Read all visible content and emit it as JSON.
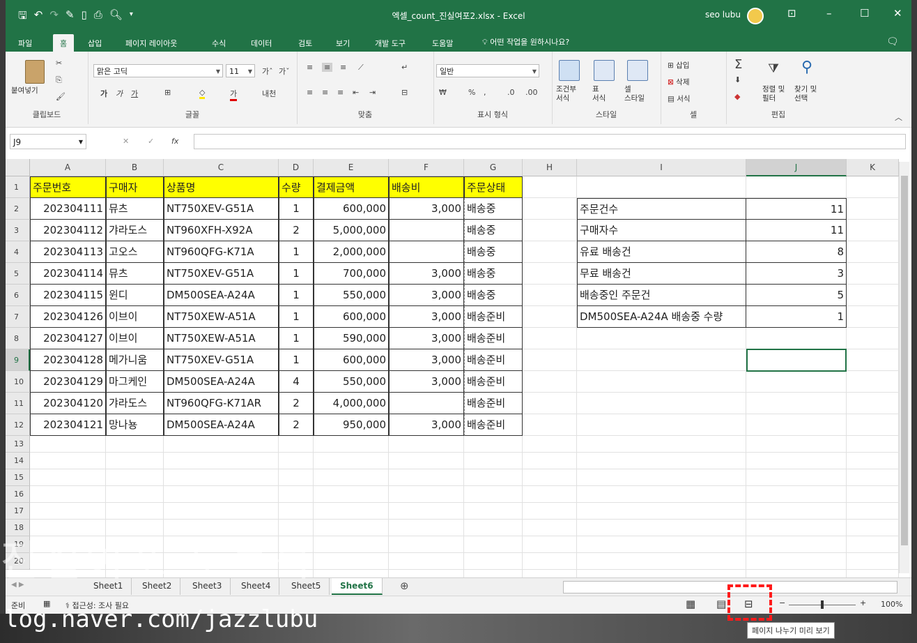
{
  "window": {
    "title": "엑셀_count_진실여포2.xlsx  -  Excel",
    "user": "seo lubu"
  },
  "ribbon_tabs": [
    "파일",
    "홈",
    "삽입",
    "페이지 레이아웃",
    "수식",
    "데이터",
    "검토",
    "보기",
    "개발 도구",
    "도움말"
  ],
  "tell_me": "어떤 작업을 원하시나요?",
  "ribbon": {
    "clipboard": {
      "paste": "붙여넣기",
      "label": "클립보드"
    },
    "font": {
      "name": "맑은 고딕",
      "size": "11",
      "label": "글꼴"
    },
    "alignment": {
      "label": "맞춤"
    },
    "number": {
      "format": "일반",
      "label": "표시 형식"
    },
    "styles": {
      "cond": "조건부\n서식",
      "table": "표\n서식",
      "cell": "셀\n스타일",
      "label": "스타일"
    },
    "cells": {
      "insert": "삽입",
      "delete": "삭제",
      "format": "서식",
      "label": "셀"
    },
    "editing": {
      "sort": "정렬 및\n필터",
      "find": "찾기 및\n선택",
      "label": "편집"
    }
  },
  "namebox": "J9",
  "columns": [
    "A",
    "B",
    "C",
    "D",
    "E",
    "F",
    "G",
    "H",
    "I",
    "J",
    "K"
  ],
  "rows": [
    "1",
    "2",
    "3",
    "4",
    "5",
    "6",
    "7",
    "8",
    "9",
    "10",
    "11",
    "12",
    "13",
    "14",
    "15",
    "16",
    "17",
    "18",
    "19",
    "20"
  ],
  "table": {
    "headers": [
      "주문번호",
      "구매자",
      "상품명",
      "수량",
      "결제금액",
      "배송비",
      "주문상태"
    ],
    "rows": [
      [
        "202304111",
        "뮤츠",
        "NT750XEV-G51A",
        "1",
        "600,000",
        "3,000",
        "배송중"
      ],
      [
        "202304112",
        "갸라도스",
        "NT960XFH-X92A",
        "2",
        "5,000,000",
        "",
        "배송중"
      ],
      [
        "202304113",
        "고오스",
        "NT960QFG-K71A",
        "1",
        "2,000,000",
        "",
        "배송중"
      ],
      [
        "202304114",
        "뮤츠",
        "NT750XEV-G51A",
        "1",
        "700,000",
        "3,000",
        "배송중"
      ],
      [
        "202304115",
        "윈디",
        "DM500SEA-A24A",
        "1",
        "550,000",
        "3,000",
        "배송중"
      ],
      [
        "202304126",
        "이브이",
        "NT750XEW-A51A",
        "1",
        "600,000",
        "3,000",
        "배송준비"
      ],
      [
        "202304127",
        "이브이",
        "NT750XEW-A51A",
        "1",
        "590,000",
        "3,000",
        "배송준비"
      ],
      [
        "202304128",
        "메가니움",
        "NT750XEV-G51A",
        "1",
        "600,000",
        "3,000",
        "배송준비"
      ],
      [
        "202304129",
        "마그케인",
        "DM500SEA-A24A",
        "4",
        "550,000",
        "3,000",
        "배송준비"
      ],
      [
        "202304120",
        "갸라도스",
        "NT960QFG-K71AR",
        "2",
        "4,000,000",
        "",
        "배송준비"
      ],
      [
        "202304121",
        "망나뇽",
        "DM500SEA-A24A",
        "2",
        "950,000",
        "3,000",
        "배송준비"
      ]
    ]
  },
  "summary": [
    {
      "label": "주문건수",
      "value": "11"
    },
    {
      "label": "구매자수",
      "value": "11"
    },
    {
      "label": "유료 배송건",
      "value": "8"
    },
    {
      "label": "무료 배송건",
      "value": "3"
    },
    {
      "label": "배송중인 주문건",
      "value": "5"
    },
    {
      "label": "DM500SEA-A24A 배송중 수량",
      "value": "1"
    }
  ],
  "sheets": [
    "Sheet1",
    "Sheet2",
    "Sheet3",
    "Sheet4",
    "Sheet5",
    "Sheet6"
  ],
  "active_sheet": "Sheet6",
  "status": {
    "ready": "준비",
    "accessibility": "접근성: 조사 필요",
    "zoom": "100%"
  },
  "tooltip": "페이지 나누기 미리 보기",
  "watermark": {
    "big": "진실여포 노트북",
    "url": "log.naver.com/jazzlubu"
  },
  "colors": {
    "excel_green": "#217346",
    "header_yellow": "#ffff00",
    "highlight_red": "#ff1a1a"
  }
}
